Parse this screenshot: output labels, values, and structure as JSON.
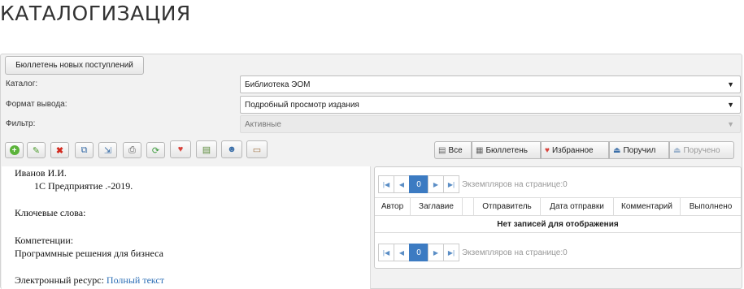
{
  "page": {
    "title": "КАТАЛОГИЗАЦИЯ"
  },
  "bulletin_button": {
    "label": "Бюллетень новых поступлений"
  },
  "form": {
    "catalog": {
      "label": "Каталог:",
      "value": "Библиотека ЭОМ"
    },
    "output_format": {
      "label": "Формат вывода:",
      "value": "Подробный просмотр издания"
    },
    "filter": {
      "label": "Фильтр:",
      "value": "Активные"
    }
  },
  "toolbar": {
    "tools": [
      "add-icon",
      "edit-icon",
      "delete-icon",
      "copy-icon",
      "export-icon",
      "print-icon",
      "refresh-icon",
      "favorite-icon",
      "attach-icon",
      "user-icon",
      "tray-icon"
    ]
  },
  "view_buttons": {
    "all": "Все",
    "bulletin": "Бюллетень",
    "favorites": "Избранное",
    "assigned": "Поручил",
    "received": "Поручено"
  },
  "document": {
    "author": "Иванов И.И.",
    "title_line": "1С Предприятие .-2019.",
    "keywords_label": "Ключевые слова:",
    "competencies_label": "Компетенции:",
    "competencies_value": "Программные решения для бизнеса",
    "resource_label": "Электронный ресурс:",
    "resource_link": "Полный текст"
  },
  "grid": {
    "pager": {
      "current_page": "0",
      "info": "Экземпляров на странице:0"
    },
    "columns": [
      "Автор",
      "Заглавие",
      "",
      "Отправитель",
      "Дата отправки",
      "Комментарий",
      "Выполнено"
    ],
    "empty_text": "Нет записей для отображения"
  },
  "colors": {
    "accent": "#3c7bc2",
    "link": "#2a6db5"
  }
}
